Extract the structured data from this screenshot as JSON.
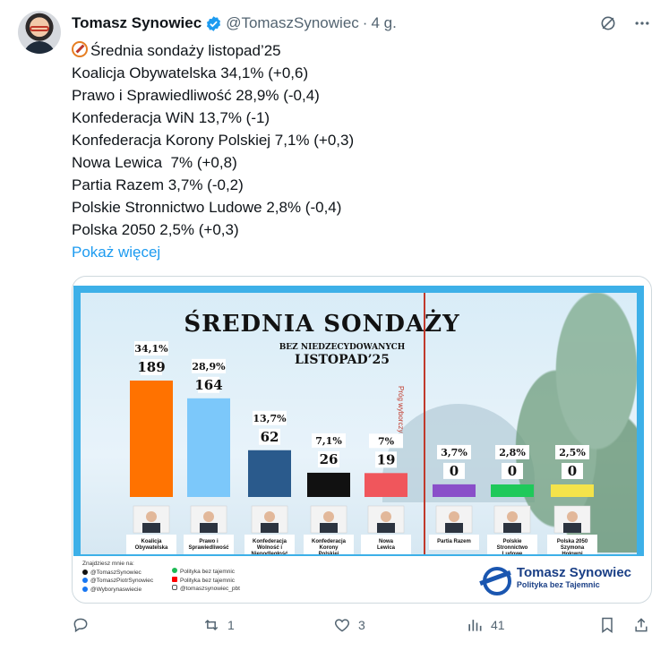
{
  "tweet": {
    "author": "Tomasz Synowiec",
    "handle": "@TomaszSynowiec",
    "separator": "·",
    "time": "4 g.",
    "lines": [
      "Średnia sondaży listopad’25",
      "Koalicja Obywatelska 34,1% (+0,6)",
      "Prawo i Sprawiedliwość 28,9% (-0,4)",
      "Konfederacja WiN 13,7% (-1)",
      "Konfederacja Korony Polskiej 7,1% (+0,3)",
      "Nowa Lewica  7% (+0,8)",
      "Partia Razem 3,7% (-0,2)",
      "Polskie Stronnictwo Ludowe 2,8% (-0,4)",
      "Polska 2050 2,5% (+0,3)"
    ],
    "show_more": "Pokaż więcej",
    "icons": {
      "grok": "grok-icon",
      "more": "more-icon",
      "first_line": "compass-icon"
    }
  },
  "poster": {
    "title": "ŚREDNIA SONDAŻY",
    "subtitle": "BEZ NIEDZECYDOWANYCH",
    "period": "LISTOPAD’25",
    "threshold_label": "Próg wyborczy",
    "footer_heading": "Znajdziesz mnie na:",
    "footer_links": [
      "@TomaszSynowiec",
      "@TomaszPiotrSynowiec",
      "@Wyborynaswiecie"
    ],
    "footer_links2": [
      "Polityka bez tajemnic",
      "Polityka bez tajemnic",
      "@tomaszsynowiec_pbt"
    ],
    "brand_name": "Tomasz Synowiec",
    "brand_tag": "Polityka bez Tajemnic"
  },
  "chart_data": {
    "type": "bar",
    "title": "ŚREDNIA SONDAŻY",
    "subtitle": "BEZ NIEDZECYDOWANYCH LISTOPAD’25",
    "categories": [
      "Koalicja Obywatelska",
      "Prawo i Sprawiedliwość",
      "Konfederacja Wolność i Niepodległość",
      "Konfederacja Korony Polskiej",
      "Nowa Lewica",
      "Partia Razem",
      "Polskie Stronnictwo Ludowe",
      "Polska 2050 Szymona Hołowni"
    ],
    "category_labels": [
      [
        "Koalicja",
        "Obywatelska"
      ],
      [
        "Prawo i",
        "Sprawiedliwość"
      ],
      [
        "Konfederacja",
        "Wolność i",
        "Niepodległość"
      ],
      [
        "Konfederacja",
        "Korony",
        "Polskiej"
      ],
      [
        "Nowa",
        "Lewica"
      ],
      [
        "Partia Razem"
      ],
      [
        "Polskie",
        "Stronnictwo",
        "Ludowe"
      ],
      [
        "Polska 2050",
        "Szymona",
        "Hołowni"
      ]
    ],
    "series": [
      {
        "values": [
          34.1,
          28.9,
          13.7,
          7.1,
          7.0,
          3.7,
          2.8,
          2.5
        ]
      }
    ],
    "percent_labels": [
      "34,1%",
      "28,9%",
      "13,7%",
      "7,1%",
      "7%",
      "3,7%",
      "2,8%",
      "2,5%"
    ],
    "seats": [
      189,
      164,
      62,
      26,
      19,
      0,
      0,
      0
    ],
    "colors": [
      "#ff7200",
      "#7cc8fa",
      "#2a5a8c",
      "#111111",
      "#f0565c",
      "#8a4fc9",
      "#1fc95a",
      "#f4e34a"
    ],
    "ylim": [
      0,
      40
    ]
  },
  "actions": {
    "replies": "",
    "retweets": "1",
    "likes": "3",
    "views": "41"
  }
}
